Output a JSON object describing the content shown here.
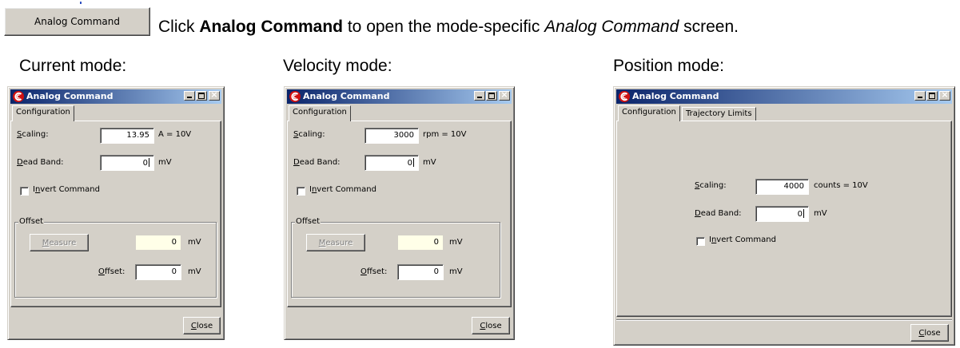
{
  "top": {
    "button_label": "Analog Command",
    "instruction_prefix": "Click ",
    "instruction_bold": "Analog Command",
    "instruction_middle": " to open the mode-specific ",
    "instruction_italic": "Analog Command",
    "instruction_suffix": " screen."
  },
  "modes": {
    "current": "Current mode:",
    "velocity": "Velocity mode:",
    "position": "Position mode:"
  },
  "current_window": {
    "title": "Analog Command",
    "tab": "Configuration",
    "scaling_label_u": "S",
    "scaling_label_rest": "caling:",
    "scaling_value": "13.95",
    "scaling_unit": "A = 10V",
    "deadband_label_u": "D",
    "deadband_label_rest": "ead Band:",
    "deadband_value": "0",
    "deadband_unit": "mV",
    "invert_u_pre": "I",
    "invert_u": "n",
    "invert_rest": "vert Command",
    "offset_group": "Offset",
    "measure_u": "M",
    "measure_rest": "easure",
    "measure_value": "0",
    "measure_unit": "mV",
    "offset_label_u": "O",
    "offset_label_rest": "ffset:",
    "offset_value": "0",
    "offset_unit": "mV",
    "close_u": "C",
    "close_rest": "lose"
  },
  "velocity_window": {
    "title": "Analog Command",
    "tab": "Configuration",
    "scaling_label_u": "S",
    "scaling_label_rest": "caling:",
    "scaling_value": "3000",
    "scaling_unit": "rpm = 10V",
    "deadband_label_u": "D",
    "deadband_label_rest": "ead Band:",
    "deadband_value": "0",
    "deadband_unit": "mV",
    "invert_u_pre": "I",
    "invert_u": "n",
    "invert_rest": "vert Command",
    "offset_group": "Offset",
    "measure_u": "M",
    "measure_rest": "easure",
    "measure_value": "0",
    "measure_unit": "mV",
    "offset_label_u": "O",
    "offset_label_rest": "ffset:",
    "offset_value": "0",
    "offset_unit": "mV",
    "close_u": "C",
    "close_rest": "lose"
  },
  "position_window": {
    "title": "Analog Command",
    "tab1": "Configuration",
    "tab2": "Trajectory Limits",
    "scaling_label_u": "S",
    "scaling_label_rest": "caling:",
    "scaling_value": "4000",
    "scaling_unit": "counts = 10V",
    "deadband_label_u": "D",
    "deadband_label_rest": "ead Band:",
    "deadband_value": "0",
    "deadband_unit": "mV",
    "invert_u_pre": "I",
    "invert_u": "n",
    "invert_rest": "vert Command",
    "close_u": "C",
    "close_rest": "lose"
  }
}
